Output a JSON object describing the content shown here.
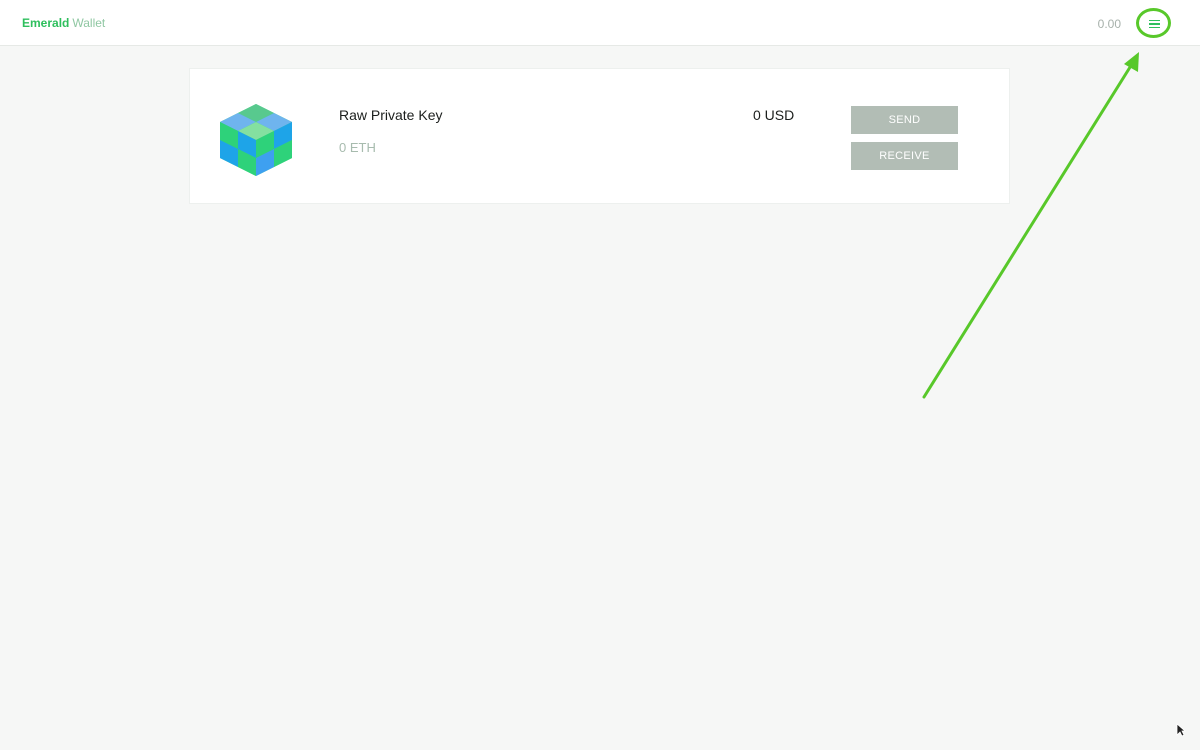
{
  "app": {
    "brand_first": "Emerald",
    "brand_second": "Wallet"
  },
  "header": {
    "total_balance": "0.00",
    "menu_icon": "hamburger-menu-icon"
  },
  "accounts": [
    {
      "name": "Raw Private Key",
      "eth_balance": "0 ETH",
      "usd_balance": "0 USD",
      "send_label": "SEND",
      "receive_label": "RECEIVE",
      "avatar_icon": "identicon-cube"
    }
  ],
  "colors": {
    "brand_green": "#2ebf5d",
    "button_gray": "#b2bdb5",
    "annotation_green": "#58c82a",
    "background": "#f6f7f6"
  }
}
